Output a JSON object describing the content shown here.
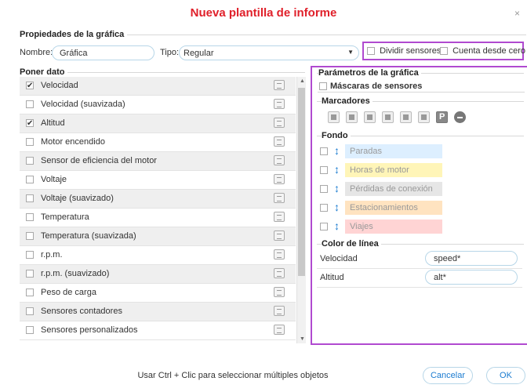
{
  "dialog": {
    "title": "Nueva plantilla de informe",
    "close": "×"
  },
  "colors": {
    "title": "#e0202a",
    "highlight": "#b04ad0",
    "accent": "#1a7bd0"
  },
  "properties": {
    "section_title": "Propiedades de la gráfica",
    "name_label": "Nombre:",
    "name_value": "Gráfica",
    "type_label": "Tipo:",
    "type_value": "Regular",
    "split_sensors_label": "Dividir sensores",
    "count_from_zero_label": "Cuenta desde cero"
  },
  "put_data": {
    "section_title": "Poner dato",
    "rows": [
      {
        "label": "Velocidad",
        "checked": true
      },
      {
        "label": "Velocidad (suavizada)",
        "checked": false
      },
      {
        "label": "Altitud",
        "checked": true
      },
      {
        "label": "Motor encendido",
        "checked": false
      },
      {
        "label": "Sensor de eficiencia del motor",
        "checked": false
      },
      {
        "label": "Voltaje",
        "checked": false
      },
      {
        "label": "Voltaje (suavizado)",
        "checked": false
      },
      {
        "label": "Temperatura",
        "checked": false
      },
      {
        "label": "Temperatura (suavizada)",
        "checked": false
      },
      {
        "label": "r.p.m.",
        "checked": false
      },
      {
        "label": "r.p.m. (suavizado)",
        "checked": false
      },
      {
        "label": "Peso de carga",
        "checked": false
      },
      {
        "label": "Sensores contadores",
        "checked": false
      },
      {
        "label": "Sensores personalizados",
        "checked": false
      }
    ]
  },
  "chart_params": {
    "section_title": "Parámetros de la gráfica",
    "masks_label": "Máscaras de sensores",
    "markers_title": "Marcadores",
    "background_title": "Fondo",
    "background_items": [
      {
        "label": "Paradas",
        "color": "#ddefff"
      },
      {
        "label": "Horas de motor",
        "color": "#fff5b8"
      },
      {
        "label": "Pérdidas de conexión",
        "color": "#e6e6e6"
      },
      {
        "label": "Estacionamientos",
        "color": "#ffe3c0"
      },
      {
        "label": "Viajes",
        "color": "#ffd4d4"
      }
    ],
    "line_color_title": "Color de línea",
    "line_colors": [
      {
        "label": "Velocidad",
        "value": "speed*"
      },
      {
        "label": "Altitud",
        "value": "alt*"
      }
    ]
  },
  "footer": {
    "hint": "Usar Ctrl + Clic para seleccionar múltiples objetos",
    "cancel_label": "Cancelar",
    "ok_label": "OK"
  }
}
